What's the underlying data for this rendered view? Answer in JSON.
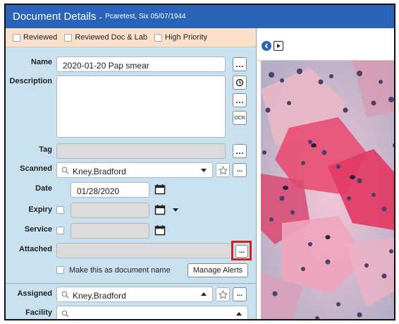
{
  "title": {
    "main": "Document Details",
    "separator": "-",
    "patient": "Pcaretest, Six 05/07/1944"
  },
  "flags": {
    "reviewed": "Reviewed",
    "reviewed_doc_lab": "Reviewed Doc & Lab",
    "high_priority": "High Priority"
  },
  "form": {
    "name_label": "Name",
    "name_value": "2020-01-20 Pap smear",
    "description_label": "Description",
    "tag_label": "Tag",
    "scanned_label": "Scanned",
    "scanned_value": "Kney,Bradford",
    "date_label": "Date",
    "date_value": "01/28/2020",
    "expiry_label": "Expiry",
    "service_label": "Service",
    "attached_label": "Attached",
    "make_doc_name": "Make this as document name",
    "manage_alerts": "Manage Alerts",
    "assigned_label": "Assigned",
    "assigned_value": "Kney,Bradford",
    "facility_label": "Facility"
  },
  "buttons": {
    "ellipsis": "…",
    "small_ellipsis": "...",
    "ocr": "OCR"
  },
  "icons": {
    "clock": "clock-icon",
    "calendar": "calendar-icon",
    "search": "search-icon",
    "star": "star-icon",
    "prev": "chevron-left-icon",
    "play": "play-icon"
  },
  "colors": {
    "title_bg": "#2a64b8",
    "panel_bg": "#c9e1ee",
    "flags_bg": "#fbe0cc",
    "highlight": "#d42020"
  }
}
